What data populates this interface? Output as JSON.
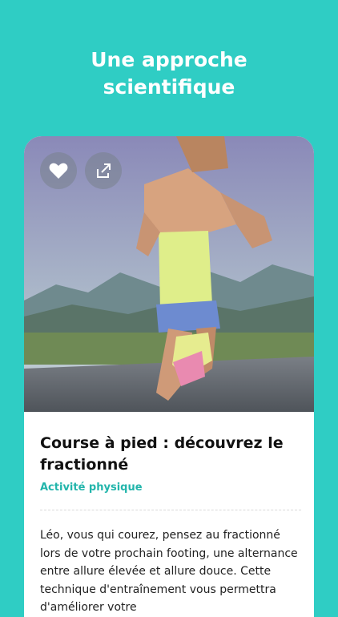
{
  "header": {
    "title_line1": "Une approche",
    "title_line2": "scientifique"
  },
  "card": {
    "image_alt": "Woman running on a road",
    "actions": {
      "like_icon": "heart-icon",
      "share_icon": "share-icon"
    },
    "article": {
      "title": "Course à pied : découvrez le fractionné",
      "category": "Activité physique",
      "excerpt": "Léo, vous qui courez, pensez au fractionné lors de votre prochain footing, une alternance entre allure élevée et allure douce. Cette technique d'entraînement vous permettra d'améliorer votre"
    }
  },
  "colors": {
    "background": "#2fcdc4",
    "accent": "#22b5ab"
  }
}
